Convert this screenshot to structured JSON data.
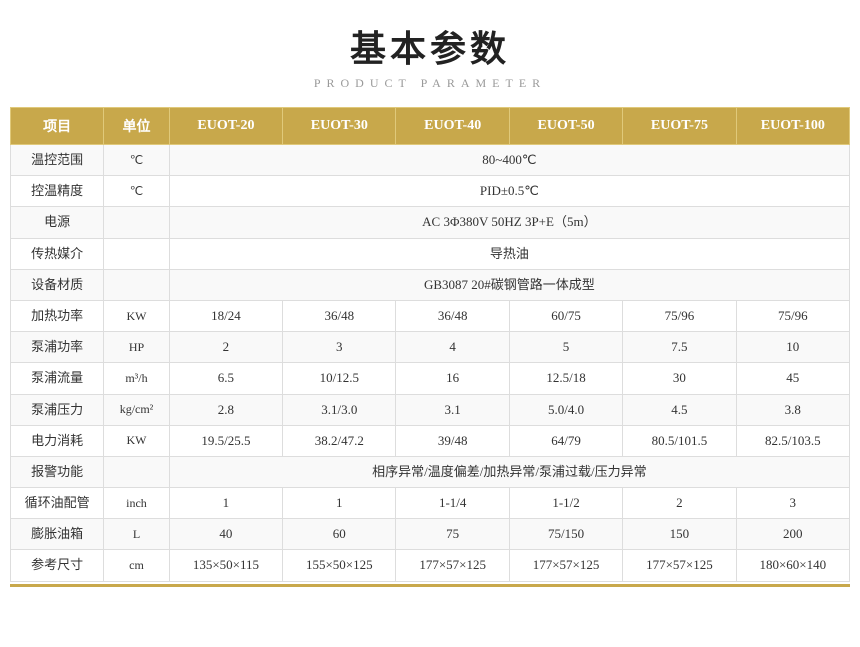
{
  "title": "基本参数",
  "subtitle": "PRODUCT PARAMETER",
  "table": {
    "headers": [
      "项目",
      "单位",
      "EUOT-20",
      "EUOT-30",
      "EUOT-40",
      "EUOT-50",
      "EUOT-75",
      "EUOT-100"
    ],
    "rows": [
      {
        "label": "温控范围",
        "unit": "℃",
        "span": true,
        "value": "80~400℃"
      },
      {
        "label": "控温精度",
        "unit": "℃",
        "span": true,
        "value": "PID±0.5℃"
      },
      {
        "label": "电源",
        "unit": "",
        "span": true,
        "value": "AC 3Φ380V 50HZ 3P+E（5m）"
      },
      {
        "label": "传热媒介",
        "unit": "",
        "span": true,
        "value": "导热油"
      },
      {
        "label": "设备材质",
        "unit": "",
        "span": true,
        "value": "GB3087   20#碳钢管路一体成型"
      },
      {
        "label": "加热功率",
        "unit": "KW",
        "span": false,
        "values": [
          "18/24",
          "36/48",
          "36/48",
          "60/75",
          "75/96",
          "75/96"
        ]
      },
      {
        "label": "泵浦功率",
        "unit": "HP",
        "span": false,
        "values": [
          "2",
          "3",
          "4",
          "5",
          "7.5",
          "10"
        ]
      },
      {
        "label": "泵浦流量",
        "unit": "m³/h",
        "span": false,
        "values": [
          "6.5",
          "10/12.5",
          "16",
          "12.5/18",
          "30",
          "45"
        ]
      },
      {
        "label": "泵浦压力",
        "unit": "kg/cm²",
        "span": false,
        "values": [
          "2.8",
          "3.1/3.0",
          "3.1",
          "5.0/4.0",
          "4.5",
          "3.8"
        ]
      },
      {
        "label": "电力消耗",
        "unit": "KW",
        "span": false,
        "values": [
          "19.5/25.5",
          "38.2/47.2",
          "39/48",
          "64/79",
          "80.5/101.5",
          "82.5/103.5"
        ]
      },
      {
        "label": "报警功能",
        "unit": "",
        "span": true,
        "value": "相序异常/温度偏差/加热异常/泵浦过载/压力异常"
      },
      {
        "label": "循环油配管",
        "unit": "inch",
        "span": false,
        "values": [
          "1",
          "1",
          "1-1/4",
          "1-1/2",
          "2",
          "3"
        ]
      },
      {
        "label": "膨胀油箱",
        "unit": "L",
        "span": false,
        "values": [
          "40",
          "60",
          "75",
          "75/150",
          "150",
          "200"
        ]
      },
      {
        "label": "参考尺寸",
        "unit": "cm",
        "span": false,
        "values": [
          "135×50×115",
          "155×50×125",
          "177×57×125",
          "177×57×125",
          "177×57×125",
          "180×60×140"
        ]
      }
    ]
  }
}
